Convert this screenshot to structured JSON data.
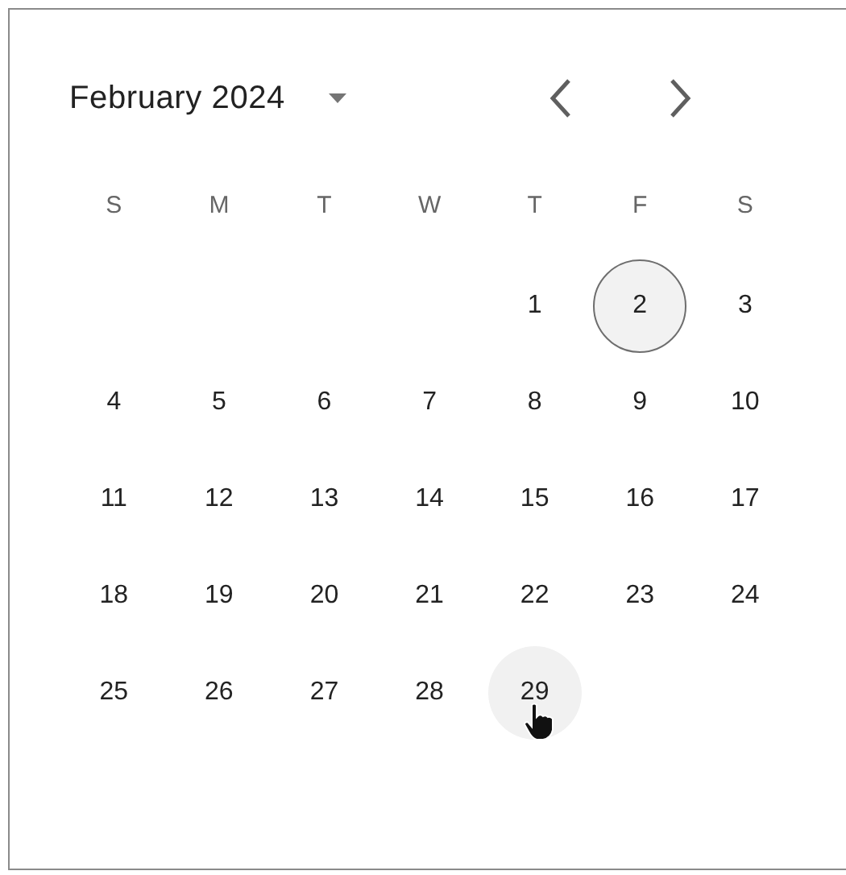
{
  "header": {
    "month_label": "February 2024"
  },
  "weekdays": [
    "S",
    "M",
    "T",
    "W",
    "T",
    "F",
    "S"
  ],
  "weeks": [
    [
      {
        "day": "1",
        "selected": false,
        "hovered": false
      },
      {
        "day": "2",
        "selected": true,
        "hovered": false
      },
      {
        "day": "3",
        "selected": false,
        "hovered": false
      }
    ],
    [
      {
        "day": "4",
        "selected": false,
        "hovered": false
      },
      {
        "day": "5",
        "selected": false,
        "hovered": false
      },
      {
        "day": "6",
        "selected": false,
        "hovered": false
      },
      {
        "day": "7",
        "selected": false,
        "hovered": false
      },
      {
        "day": "8",
        "selected": false,
        "hovered": false
      },
      {
        "day": "9",
        "selected": false,
        "hovered": false
      },
      {
        "day": "10",
        "selected": false,
        "hovered": false
      }
    ],
    [
      {
        "day": "11",
        "selected": false,
        "hovered": false
      },
      {
        "day": "12",
        "selected": false,
        "hovered": false
      },
      {
        "day": "13",
        "selected": false,
        "hovered": false
      },
      {
        "day": "14",
        "selected": false,
        "hovered": false
      },
      {
        "day": "15",
        "selected": false,
        "hovered": false
      },
      {
        "day": "16",
        "selected": false,
        "hovered": false
      },
      {
        "day": "17",
        "selected": false,
        "hovered": false
      }
    ],
    [
      {
        "day": "18",
        "selected": false,
        "hovered": false
      },
      {
        "day": "19",
        "selected": false,
        "hovered": false
      },
      {
        "day": "20",
        "selected": false,
        "hovered": false
      },
      {
        "day": "21",
        "selected": false,
        "hovered": false
      },
      {
        "day": "22",
        "selected": false,
        "hovered": false
      },
      {
        "day": "23",
        "selected": false,
        "hovered": false
      },
      {
        "day": "24",
        "selected": false,
        "hovered": false
      }
    ],
    [
      {
        "day": "25",
        "selected": false,
        "hovered": false
      },
      {
        "day": "26",
        "selected": false,
        "hovered": false
      },
      {
        "day": "27",
        "selected": false,
        "hovered": false
      },
      {
        "day": "28",
        "selected": false,
        "hovered": false
      },
      {
        "day": "29",
        "selected": false,
        "hovered": true
      }
    ]
  ]
}
